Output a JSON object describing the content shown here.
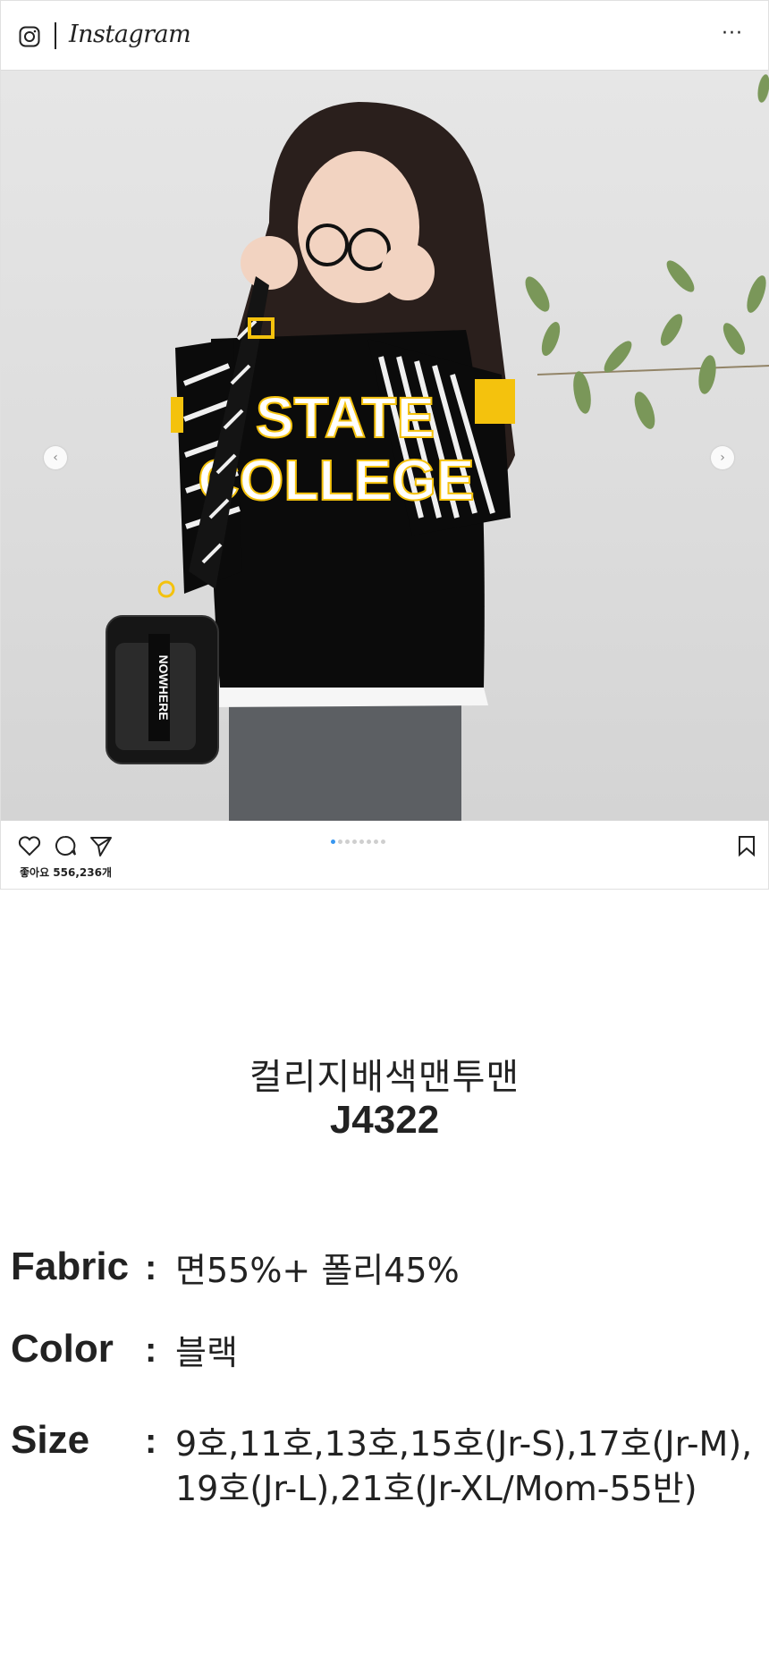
{
  "header": {
    "wordmark": "Instagram",
    "more_label": "···",
    "icons": {
      "logo": "instagram-camera-icon"
    }
  },
  "post": {
    "image_alt": "photo",
    "carousel": {
      "count": 8,
      "active_index": 0,
      "prev_label": "‹",
      "next_label": "›"
    },
    "actions": {
      "icons": [
        "heart-icon",
        "comment-icon",
        "share-icon",
        "bookmark-icon"
      ]
    },
    "likes_text": "좋아요 556,236개",
    "tee_text_line1": "STATE",
    "tee_text_line2": "COLLEGE",
    "bag_text": "NOWHERE"
  },
  "product": {
    "name": "컬리지배색맨투맨",
    "code": "J4322"
  },
  "specs": {
    "fabric_label": "Fabric",
    "fabric_value": "면55%+ 폴리45%",
    "color_label": "Color",
    "color_value": "블랙",
    "size_label": "Size",
    "size_value_line1": "9호,11호,13호,15호(Jr-S),17호(Jr-M),",
    "size_value_line2": "19호(Jr-L),21호(Jr-XL/Mom-55반)",
    "colon": ":"
  },
  "colors": {
    "accent_blue": "#3897f0",
    "tee_black": "#0b0b0b",
    "tee_yellow": "#f4c20d",
    "background": "#ffffff"
  }
}
